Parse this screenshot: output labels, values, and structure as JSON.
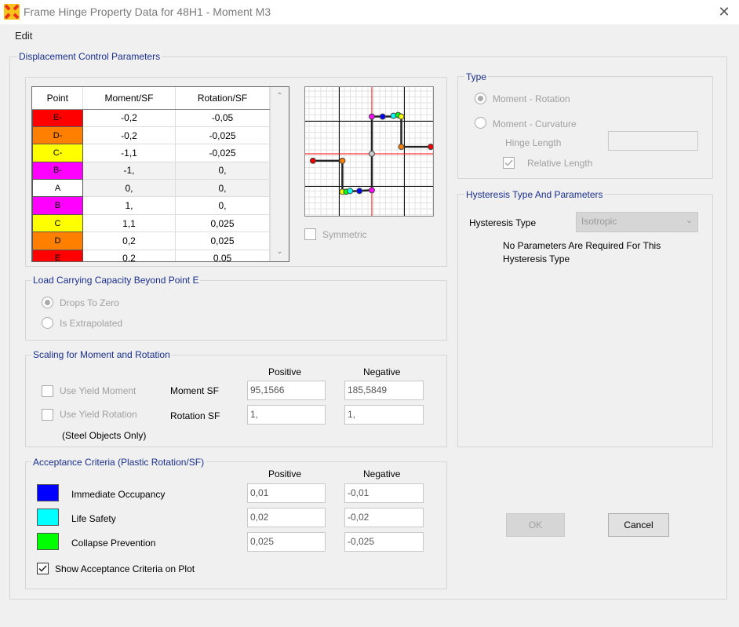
{
  "window": {
    "title": "Frame Hinge Property Data for 48H1 - Moment M3",
    "close_glyph": "✕"
  },
  "menu": {
    "edit": "Edit"
  },
  "displacement": {
    "group_label": "Displacement Control Parameters",
    "columns": [
      "Point",
      "Moment/SF",
      "Rotation/SF"
    ],
    "rows": [
      {
        "point": "E-",
        "moment": "-0,2",
        "rotation": "-0,05",
        "color": "#ff0000"
      },
      {
        "point": "D-",
        "moment": "-0,2",
        "rotation": "-0,025",
        "color": "#ff8000"
      },
      {
        "point": "C-",
        "moment": "-1,1",
        "rotation": "-0,025",
        "color": "#ffff00"
      },
      {
        "point": "B-",
        "moment": "-1,",
        "rotation": "0,",
        "color": "#ff00ff"
      },
      {
        "point": "A",
        "moment": "0,",
        "rotation": "0,",
        "color": "#ffffff"
      },
      {
        "point": "B",
        "moment": "1,",
        "rotation": "0,",
        "color": "#ff00ff"
      },
      {
        "point": "C",
        "moment": "1,1",
        "rotation": "0,025",
        "color": "#ffff00"
      },
      {
        "point": "D",
        "moment": "0,2",
        "rotation": "0,025",
        "color": "#ff8000"
      },
      {
        "point": "E",
        "moment": "0,2",
        "rotation": "0,05",
        "color": "#ff0000"
      }
    ],
    "symmetric_label": "Symmetric"
  },
  "load_capacity": {
    "group_label": "Load Carrying Capacity Beyond Point E",
    "drops_to_zero": "Drops To Zero",
    "is_extrapolated": "Is Extrapolated"
  },
  "scaling": {
    "group_label": "Scaling for Moment and Rotation",
    "positive": "Positive",
    "negative": "Negative",
    "use_yield_moment": "Use Yield Moment",
    "use_yield_rotation": "Use Yield Rotation",
    "steel_only": "(Steel Objects Only)",
    "moment_sf_label": "Moment SF",
    "rotation_sf_label": "Rotation SF",
    "moment_pos": "95,1566",
    "moment_neg": "185,5849",
    "rotation_pos": "1,",
    "rotation_neg": "1,"
  },
  "acceptance": {
    "group_label": "Acceptance Criteria (Plastic Rotation/SF)",
    "positive": "Positive",
    "negative": "Negative",
    "items": [
      {
        "label": "Immediate Occupancy",
        "pos": "0,01",
        "neg": "-0,01",
        "color": "#0000ff"
      },
      {
        "label": "Life Safety",
        "pos": "0,02",
        "neg": "-0,02",
        "color": "#00ffff"
      },
      {
        "label": "Collapse Prevention",
        "pos": "0,025",
        "neg": "-0,025",
        "color": "#00ff00"
      }
    ],
    "show_on_plot": "Show Acceptance Criteria on Plot"
  },
  "type": {
    "group_label": "Type",
    "moment_rotation": "Moment - Rotation",
    "moment_curvature": "Moment - Curvature",
    "hinge_length": "Hinge Length",
    "relative_length": "Relative Length"
  },
  "hysteresis": {
    "group_label": "Hysteresis Type And Parameters",
    "type_label": "Hysteresis Type",
    "type_value": "Isotropic",
    "note": "No Parameters Are Required For This Hysteresis Type"
  },
  "buttons": {
    "ok": "OK",
    "cancel": "Cancel"
  }
}
